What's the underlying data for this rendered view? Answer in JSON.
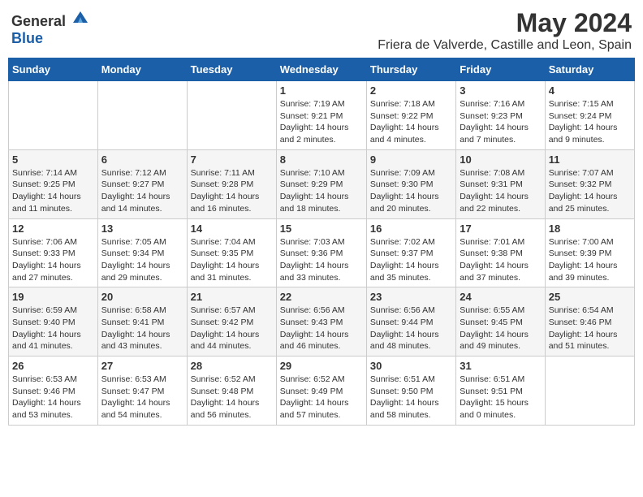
{
  "logo": {
    "general": "General",
    "blue": "Blue"
  },
  "title": "May 2024",
  "subtitle": "Friera de Valverde, Castille and Leon, Spain",
  "days_of_week": [
    "Sunday",
    "Monday",
    "Tuesday",
    "Wednesday",
    "Thursday",
    "Friday",
    "Saturday"
  ],
  "weeks": [
    [
      {
        "day": "",
        "info": ""
      },
      {
        "day": "",
        "info": ""
      },
      {
        "day": "",
        "info": ""
      },
      {
        "day": "1",
        "info": "Sunrise: 7:19 AM\nSunset: 9:21 PM\nDaylight: 14 hours and 2 minutes."
      },
      {
        "day": "2",
        "info": "Sunrise: 7:18 AM\nSunset: 9:22 PM\nDaylight: 14 hours and 4 minutes."
      },
      {
        "day": "3",
        "info": "Sunrise: 7:16 AM\nSunset: 9:23 PM\nDaylight: 14 hours and 7 minutes."
      },
      {
        "day": "4",
        "info": "Sunrise: 7:15 AM\nSunset: 9:24 PM\nDaylight: 14 hours and 9 minutes."
      }
    ],
    [
      {
        "day": "5",
        "info": "Sunrise: 7:14 AM\nSunset: 9:25 PM\nDaylight: 14 hours and 11 minutes."
      },
      {
        "day": "6",
        "info": "Sunrise: 7:12 AM\nSunset: 9:27 PM\nDaylight: 14 hours and 14 minutes."
      },
      {
        "day": "7",
        "info": "Sunrise: 7:11 AM\nSunset: 9:28 PM\nDaylight: 14 hours and 16 minutes."
      },
      {
        "day": "8",
        "info": "Sunrise: 7:10 AM\nSunset: 9:29 PM\nDaylight: 14 hours and 18 minutes."
      },
      {
        "day": "9",
        "info": "Sunrise: 7:09 AM\nSunset: 9:30 PM\nDaylight: 14 hours and 20 minutes."
      },
      {
        "day": "10",
        "info": "Sunrise: 7:08 AM\nSunset: 9:31 PM\nDaylight: 14 hours and 22 minutes."
      },
      {
        "day": "11",
        "info": "Sunrise: 7:07 AM\nSunset: 9:32 PM\nDaylight: 14 hours and 25 minutes."
      }
    ],
    [
      {
        "day": "12",
        "info": "Sunrise: 7:06 AM\nSunset: 9:33 PM\nDaylight: 14 hours and 27 minutes."
      },
      {
        "day": "13",
        "info": "Sunrise: 7:05 AM\nSunset: 9:34 PM\nDaylight: 14 hours and 29 minutes."
      },
      {
        "day": "14",
        "info": "Sunrise: 7:04 AM\nSunset: 9:35 PM\nDaylight: 14 hours and 31 minutes."
      },
      {
        "day": "15",
        "info": "Sunrise: 7:03 AM\nSunset: 9:36 PM\nDaylight: 14 hours and 33 minutes."
      },
      {
        "day": "16",
        "info": "Sunrise: 7:02 AM\nSunset: 9:37 PM\nDaylight: 14 hours and 35 minutes."
      },
      {
        "day": "17",
        "info": "Sunrise: 7:01 AM\nSunset: 9:38 PM\nDaylight: 14 hours and 37 minutes."
      },
      {
        "day": "18",
        "info": "Sunrise: 7:00 AM\nSunset: 9:39 PM\nDaylight: 14 hours and 39 minutes."
      }
    ],
    [
      {
        "day": "19",
        "info": "Sunrise: 6:59 AM\nSunset: 9:40 PM\nDaylight: 14 hours and 41 minutes."
      },
      {
        "day": "20",
        "info": "Sunrise: 6:58 AM\nSunset: 9:41 PM\nDaylight: 14 hours and 43 minutes."
      },
      {
        "day": "21",
        "info": "Sunrise: 6:57 AM\nSunset: 9:42 PM\nDaylight: 14 hours and 44 minutes."
      },
      {
        "day": "22",
        "info": "Sunrise: 6:56 AM\nSunset: 9:43 PM\nDaylight: 14 hours and 46 minutes."
      },
      {
        "day": "23",
        "info": "Sunrise: 6:56 AM\nSunset: 9:44 PM\nDaylight: 14 hours and 48 minutes."
      },
      {
        "day": "24",
        "info": "Sunrise: 6:55 AM\nSunset: 9:45 PM\nDaylight: 14 hours and 49 minutes."
      },
      {
        "day": "25",
        "info": "Sunrise: 6:54 AM\nSunset: 9:46 PM\nDaylight: 14 hours and 51 minutes."
      }
    ],
    [
      {
        "day": "26",
        "info": "Sunrise: 6:53 AM\nSunset: 9:46 PM\nDaylight: 14 hours and 53 minutes."
      },
      {
        "day": "27",
        "info": "Sunrise: 6:53 AM\nSunset: 9:47 PM\nDaylight: 14 hours and 54 minutes."
      },
      {
        "day": "28",
        "info": "Sunrise: 6:52 AM\nSunset: 9:48 PM\nDaylight: 14 hours and 56 minutes."
      },
      {
        "day": "29",
        "info": "Sunrise: 6:52 AM\nSunset: 9:49 PM\nDaylight: 14 hours and 57 minutes."
      },
      {
        "day": "30",
        "info": "Sunrise: 6:51 AM\nSunset: 9:50 PM\nDaylight: 14 hours and 58 minutes."
      },
      {
        "day": "31",
        "info": "Sunrise: 6:51 AM\nSunset: 9:51 PM\nDaylight: 15 hours and 0 minutes."
      },
      {
        "day": "",
        "info": ""
      }
    ]
  ]
}
